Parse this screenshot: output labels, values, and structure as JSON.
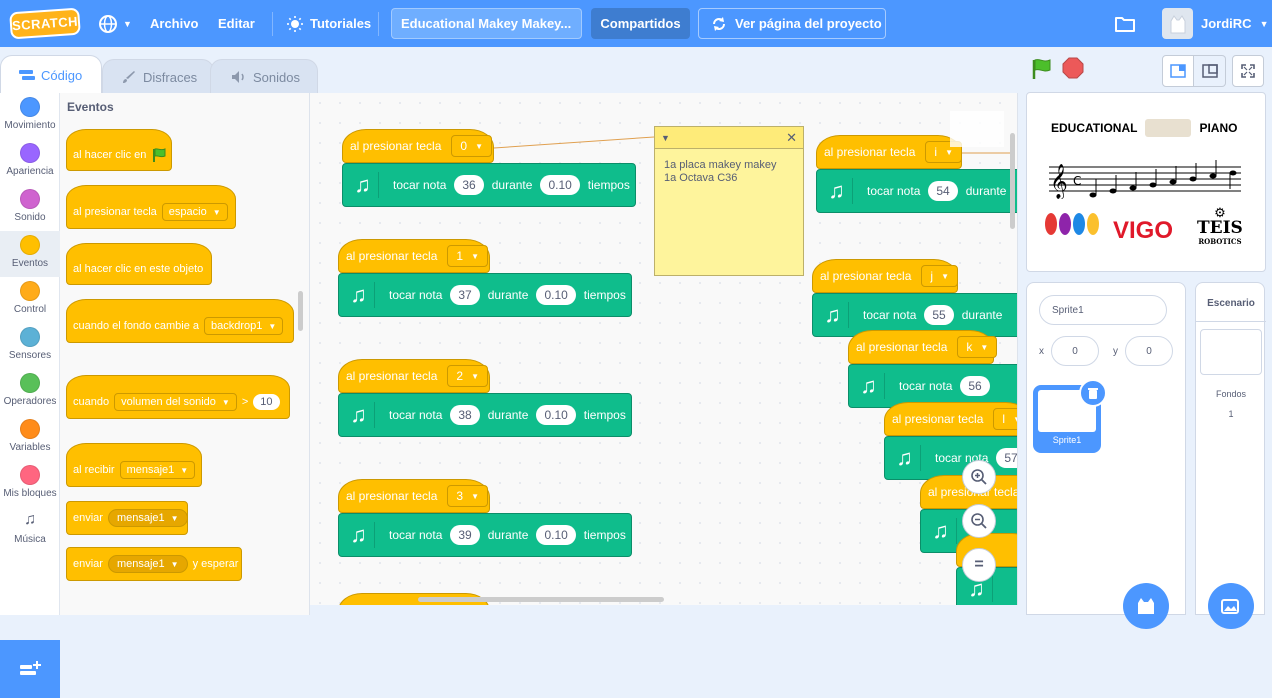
{
  "menubar": {
    "logo": "SCRATCH",
    "file": "Archivo",
    "edit": "Editar",
    "tutorials": "Tutoriales",
    "project_title": "Educational Makey Makey...",
    "share": "Compartidos",
    "see_page": "Ver página del proyecto",
    "username": "JordiRC"
  },
  "tabs": {
    "code": "Código",
    "costumes": "Disfraces",
    "sounds": "Sonidos"
  },
  "categories": [
    {
      "label": "Movimiento",
      "color": "#4c97ff"
    },
    {
      "label": "Apariencia",
      "color": "#9966ff"
    },
    {
      "label": "Sonido",
      "color": "#cf63cf"
    },
    {
      "label": "Eventos",
      "color": "#ffbf00"
    },
    {
      "label": "Control",
      "color": "#ffab19"
    },
    {
      "label": "Sensores",
      "color": "#5cb1d6"
    },
    {
      "label": "Operadores",
      "color": "#59c059"
    },
    {
      "label": "Variables",
      "color": "#ff8c1a"
    },
    {
      "label": "Mis bloques",
      "color": "#ff6680"
    },
    {
      "label": "Música",
      "color": "#0fbd8c"
    }
  ],
  "palette": {
    "title": "Eventos",
    "b1": "al hacer clic en",
    "b2": "al presionar tecla",
    "b2_key": "espacio",
    "b3": "al hacer clic en este objeto",
    "b4": "cuando el fondo cambie a",
    "b4_val": "backdrop1",
    "b5": "cuando",
    "b5_val": "volumen del sonido",
    "b5_op": ">",
    "b5_num": "10",
    "b6": "al recibir",
    "b6_val": "mensaje1",
    "b7": "enviar",
    "b7_val": "mensaje1",
    "b8": "enviar",
    "b8_val": "mensaje1",
    "b8_tail": "y esperar"
  },
  "scripts": {
    "hat_label": "al presionar tecla",
    "play_label": "tocar nota",
    "for_label": "durante",
    "beats_label": "tiempos",
    "left": [
      {
        "key": "0",
        "note": "36",
        "beats": "0.10"
      },
      {
        "key": "1",
        "note": "37",
        "beats": "0.10"
      },
      {
        "key": "2",
        "note": "38",
        "beats": "0.10"
      },
      {
        "key": "3",
        "note": "39",
        "beats": "0.10"
      }
    ],
    "right": [
      {
        "key": "i",
        "note": "54"
      },
      {
        "key": "j",
        "note": "55"
      },
      {
        "key": "k",
        "note": "56"
      },
      {
        "key": "l",
        "note": "57"
      }
    ],
    "partial": "al presionar tecla"
  },
  "comment": {
    "text": "1a placa makey makey\n1a Octava C36"
  },
  "stage": {
    "title_left": "EDUCATIONAL",
    "title_right": "PIANO",
    "logo_vigo": "VIGO",
    "logo_teis": "TEIS",
    "logo_teis_sub": "ROBOTICS"
  },
  "sprite": {
    "name_label": "Sprite1",
    "x_label": "x",
    "x_val": "0",
    "y_label": "y",
    "y_val": "0",
    "thumb_name": "Sprite1"
  },
  "stage_pane": {
    "title": "Escenario",
    "backdrops_label": "Fondos",
    "backdrops_count": "1"
  }
}
